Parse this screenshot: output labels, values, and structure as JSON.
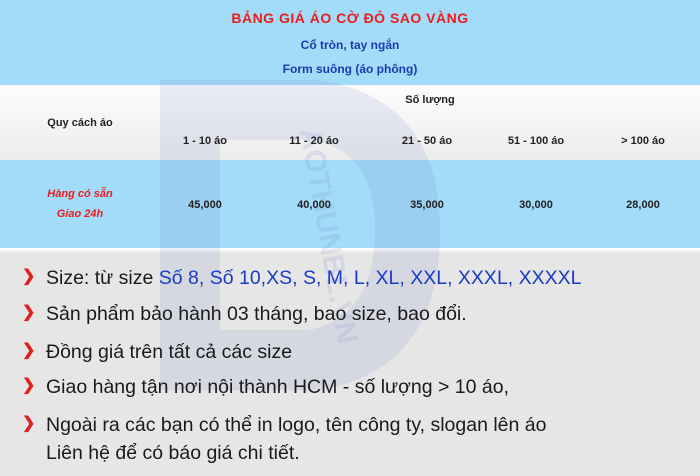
{
  "header": {
    "title": "BẢNG GIÁ ÁO CỜ ĐỎ SAO VÀNG",
    "subtitle_1": "Cổ tròn, tay ngắn",
    "subtitle_2": "Form suông (áo phông)"
  },
  "table": {
    "spec_label": "Quy cách áo",
    "qty_label": "Số lượng",
    "columns": [
      "1 - 10 áo",
      "11 - 20 áo",
      "21 - 50 áo",
      "51 - 100 áo",
      "> 100 áo"
    ],
    "row_label_line1": "Hàng có sẵn",
    "row_label_line2": "Giao 24h",
    "prices": [
      "45,000",
      "40,000",
      "35,000",
      "30,000",
      "28,000"
    ]
  },
  "notes": {
    "size_prefix": "Size: từ size ",
    "size_list": "Số 8, Số 10,XS, S, M, L, XL, XXL, XXXL, XXXXL",
    "warranty": "Sản phẩm bảo hành 03 tháng, bao size, bao đổi.",
    "same_price": "Đồng giá trên tất cả các size",
    "delivery": "Giao hàng tận nơi nội thành HCM - số lượng > 10 áo,",
    "logo_line1": "Ngoài ra các bạn có thể in logo, tên công ty, slogan lên áo",
    "logo_line2": "Liên hệ để có báo giá chi tiết."
  },
  "watermark": {
    "text": "AOTHUNBL.VN"
  },
  "colors": {
    "band_blue": "#a3dcf8",
    "title_red": "#ee1c1c",
    "subtitle_blue": "#1a3bb0",
    "bullet_red": "#e0201a",
    "notes_bg": "#e6e6e6"
  }
}
